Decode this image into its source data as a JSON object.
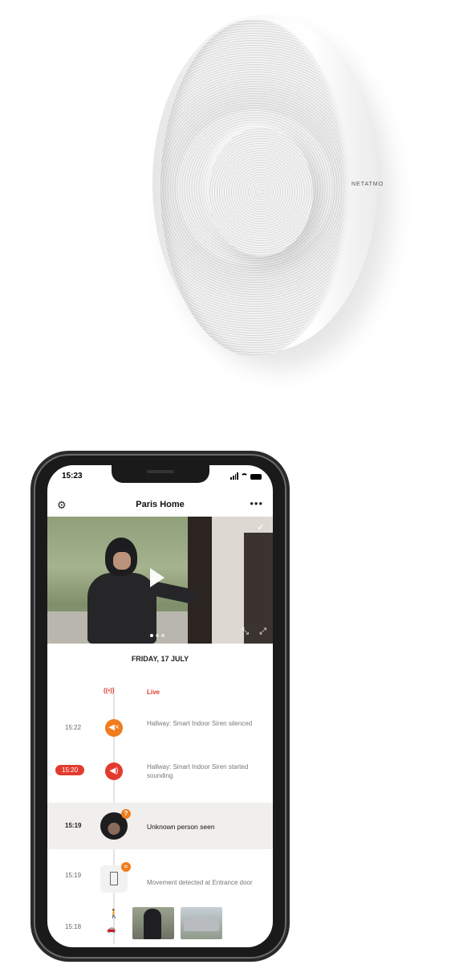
{
  "product": {
    "brand_label": "NETATMO"
  },
  "phone": {
    "status_time": "15:23",
    "header": {
      "title": "Paris Home",
      "settings_icon": "gear-icon",
      "more_icon": "more-dots-icon"
    },
    "date_heading": "FRIDAY, 17 JULY",
    "timeline": [
      {
        "time": "",
        "icon": "live-signal-icon",
        "text": "Live",
        "icon_color": "#e23b2e"
      },
      {
        "time": "15:22",
        "icon": "siren-muted-icon",
        "text": "Hallway: Smart Indoor Siren silenced",
        "icon_color": "#f07c1e"
      },
      {
        "time": "15:20",
        "icon": "siren-sounding-icon",
        "text": "Hallway: Smart Indoor Siren started sounding",
        "icon_color": "#e23b2e"
      },
      {
        "time": "15:19",
        "icon": "unknown-person-avatar",
        "text": "Unknown person seen"
      },
      {
        "time": "15:19",
        "icon": "door-icon",
        "text": "Movement detected at Entrance door"
      },
      {
        "time": "15:18",
        "icon": "walking-person-icon",
        "text": ""
      }
    ]
  }
}
